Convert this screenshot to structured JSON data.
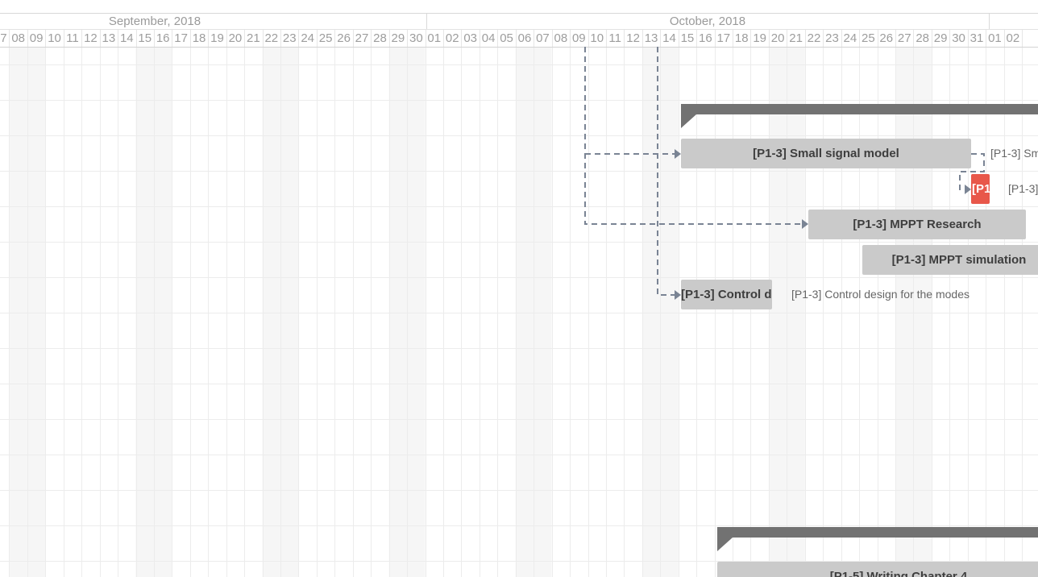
{
  "colors": {
    "task_bar": "#cacaca",
    "critical_bar": "#e8574a",
    "group_bar": "#727272",
    "link_line": "#7a8494",
    "grid_line": "#ececec",
    "weekend_shade": "#f6f6f6"
  },
  "timeline": {
    "months": [
      {
        "label": "September, 2018"
      },
      {
        "label": "October, 2018"
      }
    ],
    "days": [
      "07",
      "08",
      "09",
      "10",
      "11",
      "12",
      "13",
      "14",
      "15",
      "16",
      "17",
      "18",
      "19",
      "20",
      "21",
      "22",
      "23",
      "24",
      "25",
      "26",
      "27",
      "28",
      "29",
      "30",
      "01",
      "02",
      "03",
      "04",
      "05",
      "06",
      "07",
      "08",
      "09",
      "10",
      "11",
      "12",
      "13",
      "14",
      "15",
      "16",
      "17",
      "18",
      "19",
      "20",
      "21",
      "22",
      "23",
      "24",
      "25",
      "26",
      "27",
      "28",
      "29",
      "30",
      "31",
      "01",
      "02"
    ]
  },
  "tasks": [
    {
      "label": "[P1-3] Small signal model",
      "side_label": "[P1-3] Sm"
    },
    {
      "label": "[P1",
      "side_label": "[P1-3]"
    },
    {
      "label": "[P1-3] MPPT Research",
      "side_label": ""
    },
    {
      "label": "[P1-3] MPPT simulation",
      "side_label": ""
    },
    {
      "label": "[P1-3] Control d",
      "side_label": "[P1-3] Control design for the modes"
    },
    {
      "label": "[P1-5] Writing Chapter 4",
      "side_label": ""
    }
  ]
}
